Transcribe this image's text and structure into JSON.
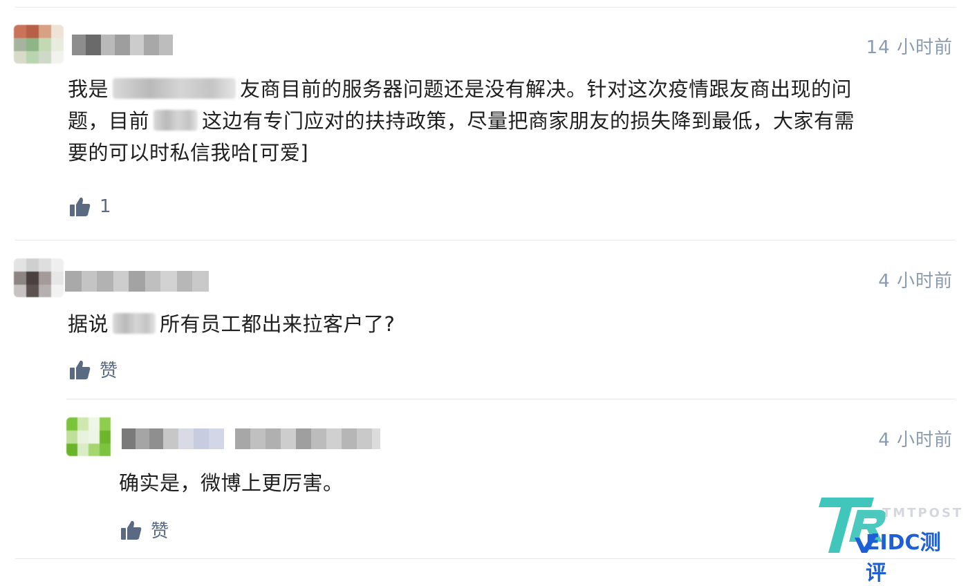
{
  "comments": [
    {
      "time": "14 小时前",
      "text_part1": "我是",
      "text_part2": "友商目前的服务器问题还是没有解决。针对这次疫情跟友商出现的问",
      "text_line2a": "题，目前",
      "text_line2b": "这边有专门应对的扶持政策，尽量把商家朋友的损失降到最低，大家有需",
      "text_line3": "要的可以时私信我哈[可爱]",
      "like_label": "1"
    },
    {
      "time": "4 小时前",
      "text_part1": "据说",
      "text_part2": "所有员工都出来拉客户了?",
      "like_label": "赞"
    },
    {
      "time": "4 小时前",
      "text": "确实是，微博上更厉害。",
      "like_label": "赞"
    }
  ],
  "watermark": {
    "small_text": "TMTPOST",
    "brand_text": "EIDC测评"
  },
  "colors": {
    "time": "#8a9bb0",
    "like": "#5a6a82",
    "divider": "#e9e9e9",
    "brand": "#1f5fd6",
    "brand_mark": "#2bc0b4"
  }
}
